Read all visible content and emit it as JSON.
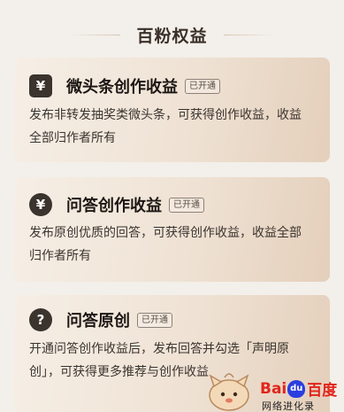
{
  "section": {
    "title": "百粉权益"
  },
  "cards": [
    {
      "icon": "yen-icon",
      "icon_glyph": "¥",
      "title": "微头条创作收益",
      "status": "已开通",
      "desc_line1": "发布非转发抽奖类微头条，可获得创作收益，收益",
      "desc_line2": "全部归作者所有"
    },
    {
      "icon": "yen-circle-icon",
      "icon_glyph": "¥",
      "title": "问答创作收益",
      "status": "已开通",
      "desc_line1": "发布原创优质的回答，可获得创作收益，收益全部",
      "desc_line2": "归作者所有"
    },
    {
      "icon": "question-circle-icon",
      "icon_glyph": "?",
      "title": "问答原创",
      "status": "已开通",
      "desc_line1": "开通问答创作收益后，发布回答并勾选「声明原",
      "desc_line2": "创」，可获得更多推荐与创作收益"
    }
  ],
  "watermark": {
    "logo_bai": "Bai",
    "logo_du": "du",
    "logo_cn": "百度",
    "subtitle": "网络进化录"
  }
}
